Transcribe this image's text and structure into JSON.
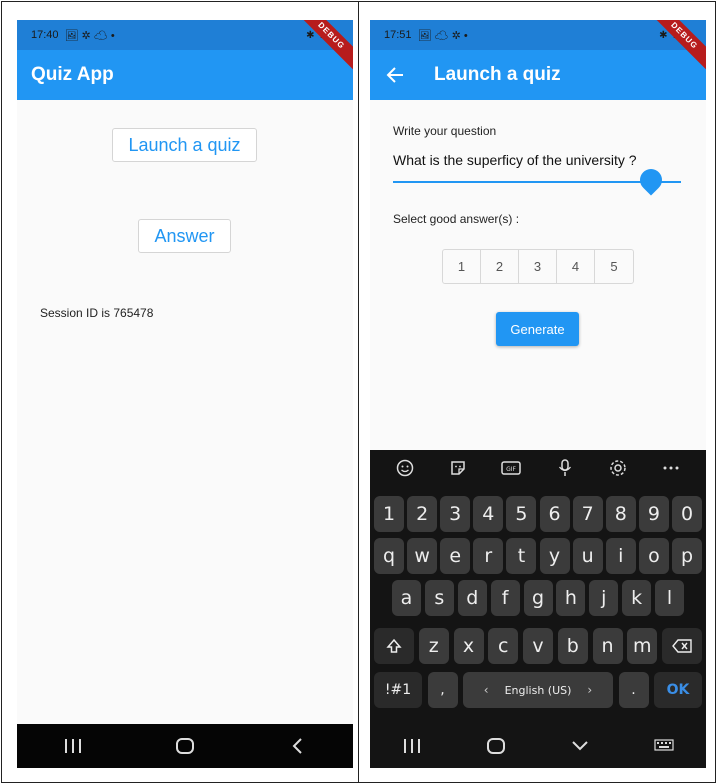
{
  "left_screen": {
    "status_time": "17:40",
    "status_icons": "🖼 ✲ ☁ •",
    "status_right": "✱ ⊿ ▮",
    "debug_banner": "DEBUG",
    "app_title": "Quiz App",
    "launch_button": "Launch a quiz",
    "answer_button": "Answer",
    "session_text": "Session ID is 765478"
  },
  "right_screen": {
    "status_time": "17:51",
    "status_icons": "🖼 ☁ ✲ •",
    "status_right": "✱ ⊿ ▮",
    "debug_banner": "DEBUG",
    "app_title": "Launch a quiz",
    "question_label": "Write your question",
    "question_value": "What is the superficy of the university ?",
    "select_label": "Select good answer(s) :",
    "answers": [
      "1",
      "2",
      "3",
      "4",
      "5"
    ],
    "generate_button": "Generate"
  },
  "keyboard": {
    "row1": [
      "1",
      "2",
      "3",
      "4",
      "5",
      "6",
      "7",
      "8",
      "9",
      "0"
    ],
    "row2": [
      "q",
      "w",
      "e",
      "r",
      "t",
      "y",
      "u",
      "i",
      "o",
      "p"
    ],
    "row3": [
      "a",
      "s",
      "d",
      "f",
      "g",
      "h",
      "j",
      "k",
      "l"
    ],
    "row4": [
      "z",
      "x",
      "c",
      "v",
      "b",
      "n",
      "m"
    ],
    "symbols_key": "!#1",
    "comma_key": ",",
    "space_label": "English (US)",
    "period_key": ".",
    "ok_key": "OK"
  },
  "colors": {
    "primary": "#2196f3",
    "status_bar": "#1f7fd6",
    "debug": "#b71c1c",
    "keyboard_bg": "#141414"
  }
}
